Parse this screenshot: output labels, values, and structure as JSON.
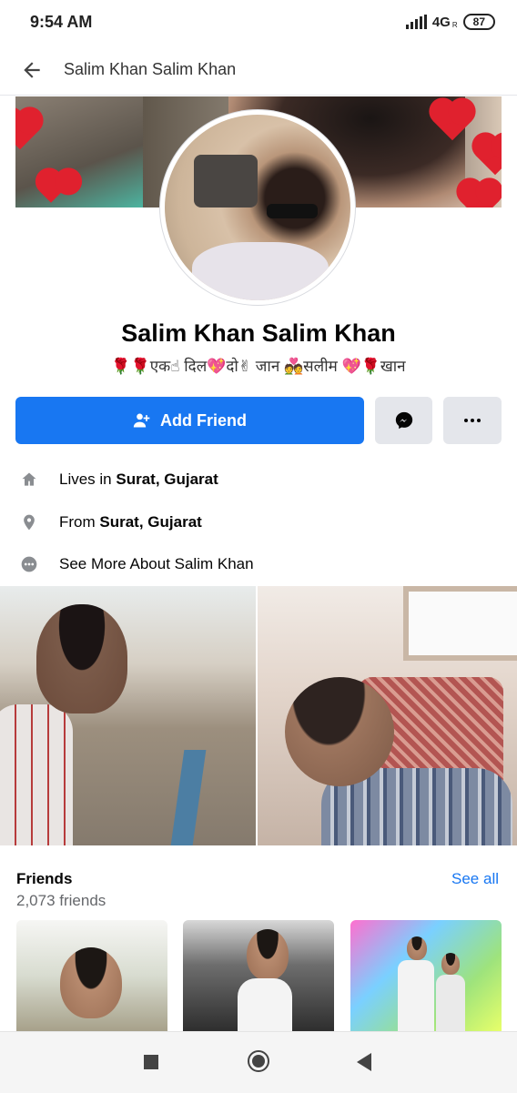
{
  "status_bar": {
    "time": "9:54 AM",
    "network": "4G",
    "network_sub": "R",
    "battery": "87"
  },
  "header": {
    "title": "Salim Khan Salim Khan"
  },
  "profile": {
    "name": "Salim Khan Salim Khan",
    "bio_parts": [
      "🌹🌹",
      "एक☝ दिल",
      "💖",
      "दो✌ जान",
      "💑",
      "सलीम",
      "💖🌹",
      "खान"
    ]
  },
  "actions": {
    "add_friend_label": "Add Friend"
  },
  "about": {
    "lives_prefix": "Lives in ",
    "lives_value": "Surat, Gujarat",
    "from_prefix": "From ",
    "from_value": "Surat, Gujarat",
    "see_more_label": "See More About Salim Khan"
  },
  "friends": {
    "title": "Friends",
    "count": "2,073 friends",
    "see_all_label": "See all"
  },
  "colors": {
    "accent": "#1877f2",
    "secondary_button": "#e4e6eb",
    "muted_text": "#65676b"
  }
}
